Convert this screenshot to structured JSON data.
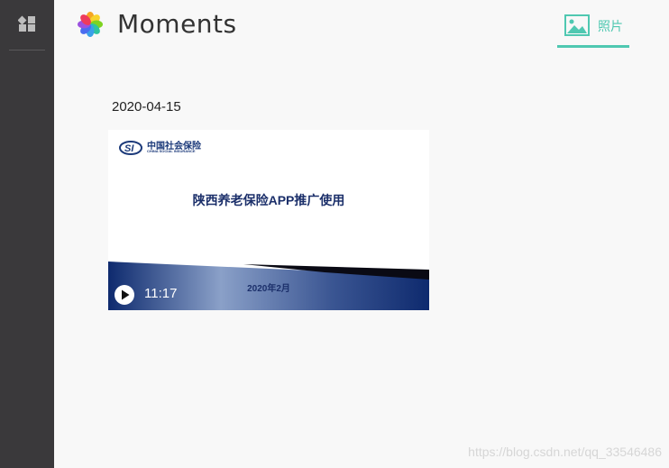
{
  "app": {
    "title": "Moments"
  },
  "sidebar": {
    "icon": "apps-grid-icon"
  },
  "header": {
    "tab_label": "照片",
    "tab_icon": "image-icon",
    "accent": "#4fc8b1"
  },
  "gallery": {
    "group_date": "2020-04-15",
    "item": {
      "type": "video",
      "org_name_cn": "中国社会保险",
      "org_name_en": "CHINA SOCIAL INSURANCE",
      "title": "陕西养老保险APP推广使用",
      "date_text": "2020年2月",
      "duration": "11:17"
    }
  },
  "watermark": "https://blog.csdn.net/qq_33546486"
}
